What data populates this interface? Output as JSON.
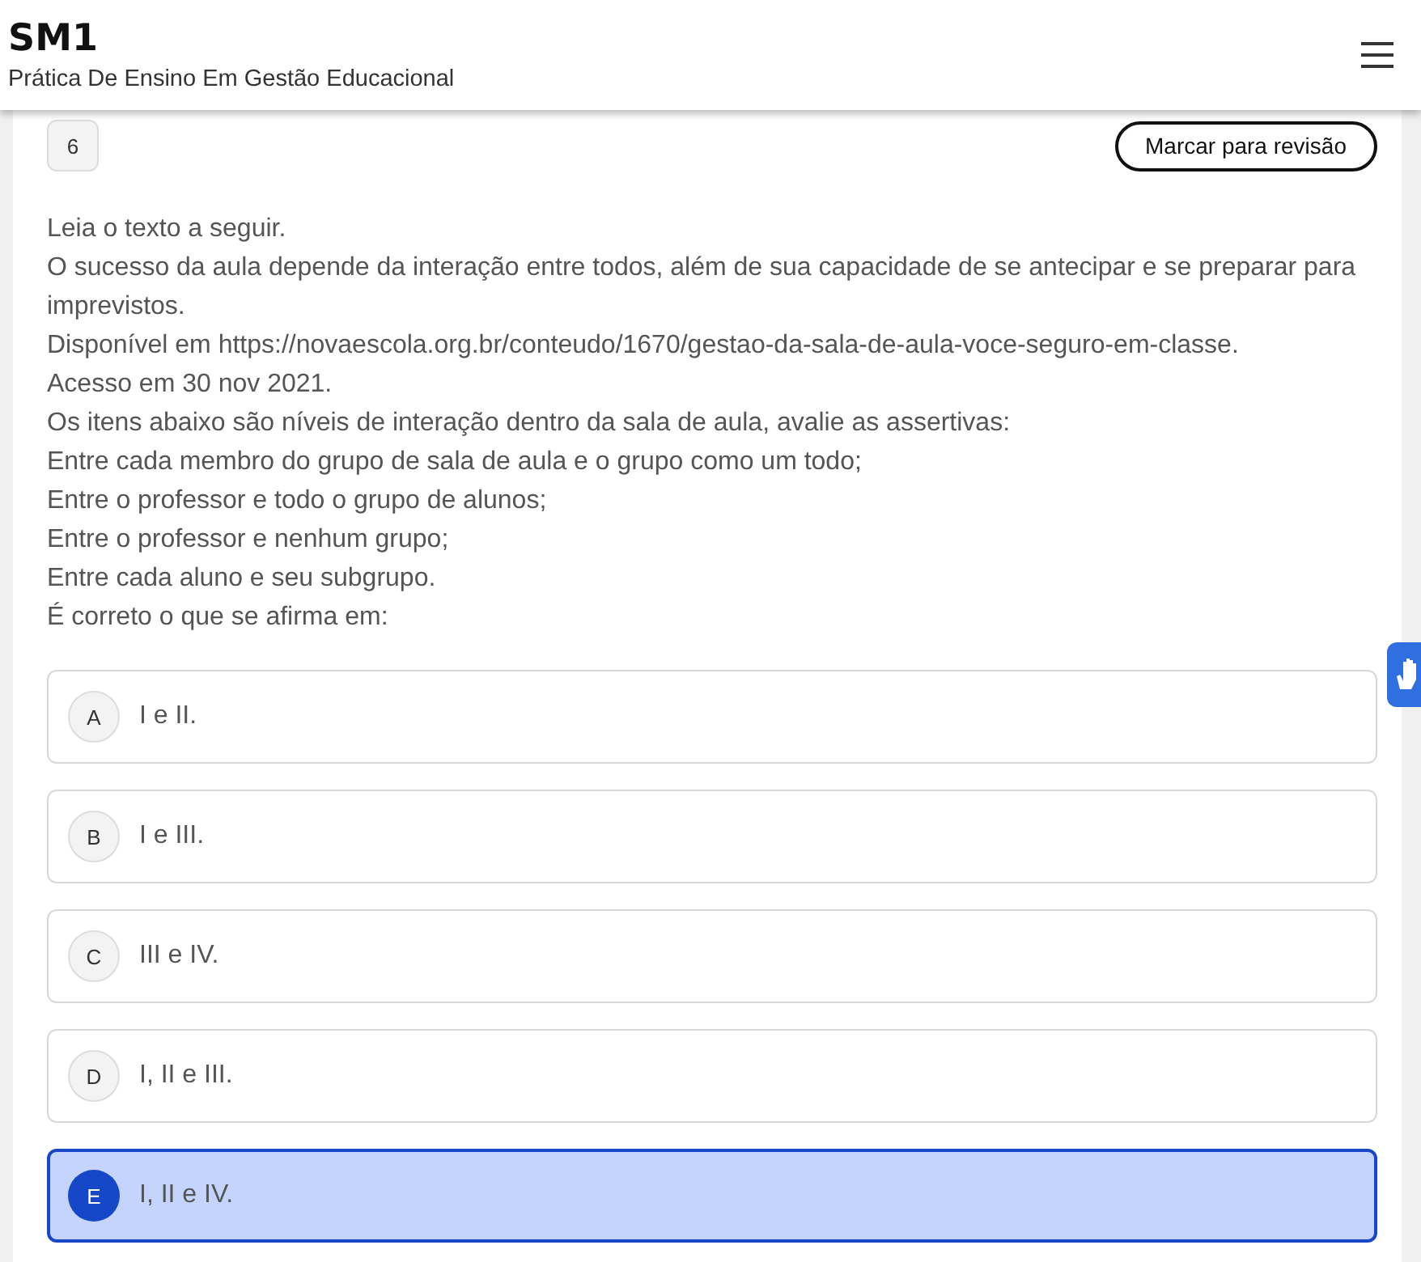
{
  "header": {
    "title": "SM1",
    "subtitle": "Prática De Ensino Em Gestão Educacional"
  },
  "question": {
    "number": "6",
    "review_button": "Marcar para revisão",
    "lines": [
      "Leia o texto a seguir.",
      "O sucesso da aula depende da interação entre todos, além de sua capacidade de se antecipar e se preparar para imprevistos.",
      "Disponível em https://novaescola.org.br/conteudo/1670/gestao-da-sala-de-aula-voce-seguro-em-classe.",
      "Acesso em 30 nov 2021.",
      "Os itens abaixo são níveis de interação dentro da sala de aula, avalie as assertivas:",
      "Entre cada membro do grupo de sala de aula e o grupo como um todo;",
      "Entre o professor e todo o grupo de alunos;",
      "Entre o professor e nenhum grupo;",
      "Entre cada aluno e seu subgrupo.",
      "É correto o que se afirma em:"
    ],
    "options": [
      {
        "letter": "A",
        "text": "I e II.",
        "selected": false
      },
      {
        "letter": "B",
        "text": "I e III.",
        "selected": false
      },
      {
        "letter": "C",
        "text": "III e IV.",
        "selected": false
      },
      {
        "letter": "D",
        "text": "I, II e III.",
        "selected": false
      },
      {
        "letter": "E",
        "text": "I, II e IV.",
        "selected": true
      }
    ]
  }
}
